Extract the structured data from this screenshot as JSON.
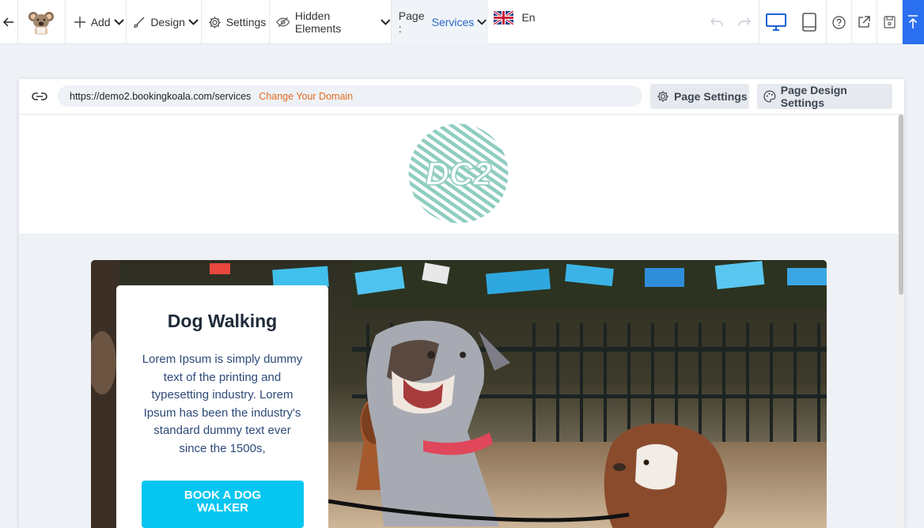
{
  "toolbar": {
    "add_label": "Add",
    "design_label": "Design",
    "settings_label": "Settings",
    "hidden_label": "Hidden Elements",
    "page_prefix": "Page :",
    "page_value": "Services",
    "language": "En",
    "accent": "#2a6ff0"
  },
  "urlbar": {
    "url": "https://demo2.bookingkoala.com/services",
    "change_domain": "Change Your Domain",
    "page_settings": "Page Settings",
    "page_design_settings": "Page Design Settings"
  },
  "site": {
    "logo_text": "DC2",
    "logo_color": "#8fcdc1"
  },
  "hero": {
    "title": "Dog Walking",
    "description": "Lorem Ipsum is simply dummy text of the printing and typesetting industry. Lorem Ipsum has been the industry's standard dummy text ever since the 1500s,",
    "cta": "BOOK A DOG WALKER",
    "cta_color": "#06c6f1"
  }
}
